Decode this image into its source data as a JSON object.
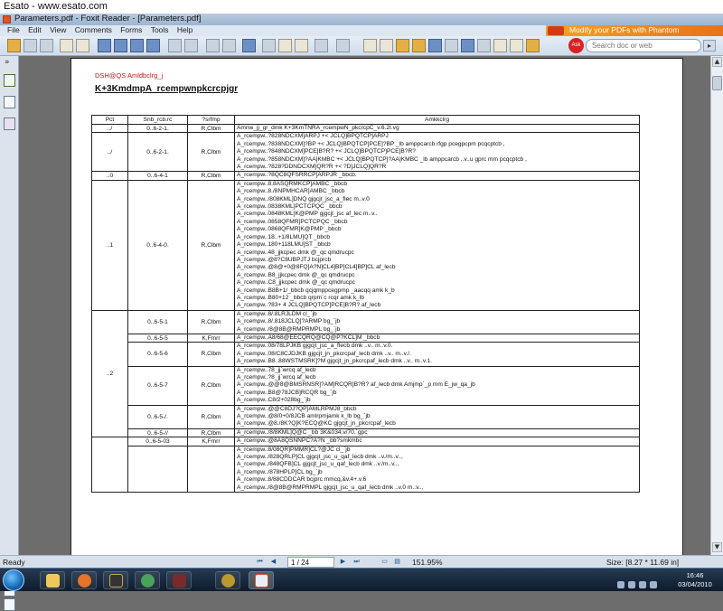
{
  "browser": {
    "title": "Esato - www.esato.com"
  },
  "window": {
    "title": "Parameters.pdf - Foxit Reader - [Parameters.pdf]"
  },
  "menu": [
    "File",
    "Edit",
    "View",
    "Comments",
    "Forms",
    "Tools",
    "Help"
  ],
  "promo": {
    "text": "Modify your PDFs with Phantom"
  },
  "search": {
    "brand": "Ask",
    "placeholder": "Search doc or web"
  },
  "doc": {
    "title": "DSH@QS Amldbclrg_j",
    "subtitle": "K+3KmdmpA_rcempwnpkcrcpjgr",
    "headers": [
      "Pct",
      "Snb_rcb.rc",
      "?srfmp",
      "Amkkclrg"
    ],
    "groups": [
      {
        "pct": "../",
        "subs": [
          {
            "code": "0..6-2-1.",
            "fmt": "R,Clbm",
            "lines": [
              "Amnw_jj_gr_dmk K+3KmTNRA_rcempwN_pkcrcpC_v.6.2I.vg"
            ]
          }
        ]
      },
      {
        "pct": "../",
        "subs": [
          {
            "code": "0..6-2-1.",
            "fmt": "R,Clbm",
            "lines": [
              "A_rcempw..?828NDCXM]ARPJ +< JCLQ]BPQTCP]ARPJ",
              "A_rcempw..?838NDCXM]?BP +< JCLQ]BPQTCP]PCE]?BP _lb amppcarcb rfgp pcegpcpm pcqcptcb ,",
              "A_rcempw..?848NDCXM]PCE]B?R? +< JCLQ]BPQTCP]PCE]B?R?",
              "A_rcempw..?858NDCXM]?AA]KMBC +< JCLQ]BPQTCP]?AA]KMBC _lb amppcarcb ..v..u gprc mm pcqcptcb ,",
              "A_rcempw..?828?DDNDCXM]QR?R +< ?D]JCLQ]QR?R"
            ]
          }
        ]
      },
      {
        "pct": "..0",
        "subs": [
          {
            "code": "0..6-4-1",
            "fmt": "R,Clbm",
            "lines": [
              "A_rcempw..?8QC8QFSRRCP]ARPJR _bbcb."
            ]
          }
        ]
      },
      {
        "pct": "..1",
        "subs": [
          {
            "code": "0..6-4-0.",
            "fmt": "R,Clbm",
            "lines": [
              "A_rcempw..8.8ASQRMKCP]AMBC _bbcb",
              "A_rcempw..8./8NPMHCAR]AMBC _bbcb",
              "A_rcempw../808KML]DNQ gjgcjt_jsc_a_flec m..v.0",
              "A_rcempw..0838KML]PCTCPQC _bbcb",
              "A_rcempw..0848KML]K@PMP gjgcjt_jsc af_lec m..v..",
              "A_rcempw..0858QFMR]PCTCPQC _bbcb",
              "A_rcempw..0868QFMR]K@PMP _bbcb",
              "A_rcempw..18..+1/8LMU]QT _bbcb",
              "A_rcempw..180+118LMU]ST _bbcb",
              "A_rcempw..48_jjkcpec dmk @_qc qmdrucpc",
              "A_rcempw..@8?C8UBPJTJ bcjprcb",
              "A_rcempw..@8@+0@8FQ]A?N]CL4]BP]CL4]BP]CL af_lecb",
              "A_rcempw..B8_jjkcpec dmk @_qc qmdrucpc",
              "A_rcempw..C8_jjkcpec dmk @_qc qmdrucpc",
              "A_rcempw..B8B+1/_bbcb qcjqmppcegpmp _aacqq amk k_b",
              "A_rcempw..B80+12 _bbcb qrpm`c rcqr amk k_lb",
              "A_rcempw..?83+ 4 JCLQ]BPQTCP]PCE]B?R? af_lecb"
            ]
          }
        ]
      },
      {
        "pct": "..2",
        "subs": [
          {
            "code": "0..6-5-1",
            "fmt": "R,Clbm",
            "lines": [
              "A_rcempw..8/.8LRJLDM cl_`jb",
              "A_rcempw..8/.818JCLQ]?ARMP bg_`jb",
              "A_rcempw../8@8B@RMPRMPL bg_`jb"
            ]
          },
          {
            "code": "0..6-5-5",
            "fmt": "K,Fmrr",
            "lines": [
              "A_rcempw..A8/68@EECQRQ@CQ@P?KCL]M _bbcb"
            ]
          },
          {
            "code": "0..6-5-6",
            "fmt": "R,Clbm",
            "lines": [
              "A_rcempw..08/78LPJKB gjgcjt_jsc_a_flecb dmk ..v.. m..v.0.",
              "A_rcempw..08/C8CJDJKB gjgcjt_jn_pkcrcpaf_lecb dmk ..v.. m..v./.",
              "A_rcempw..B8..88WSTMSRK]?M gjgcjt_jn_pkcrcpaf_lecb dmk ..v.. m..v.1."
            ]
          },
          {
            "code": "0..6-5-7",
            "fmt": "R,Clbm",
            "lines": [
              "A_rcempw..78_jj`wrcq af_lecb",
              "A_rcempw..?8_jj`wrcq af_lecb",
              "A_rcempw..@@8@BMSRNSR]?AM]RCQR]B?R? af_lecb dmk Amjmp`_p mm E_jw_qa_jb",
              "A_rcempw..B8@78JCB]RCQR bg_`jb",
              "A_rcempw..C8/2+028bg_`jb"
            ]
          },
          {
            "code": "0..6-5-/.",
            "fmt": "R,Clbm",
            "lines": [
              "A_rcempw..@@C8DJ?QP]AMLRPMJ8_bbcb",
              "A_rcempw..@8/0+0/8JCB amlrpmjamk k_lb bg_`jb",
              "A_rcempw..@8./8K?Q]K?ECQ@KC gjgcjt_jn_pkcrcpaf_lecb"
            ]
          },
          {
            "code": "0..6-5-//",
            "fmt": "R,Clbm",
            "lines": [
              "A_rcempw../8/8KML]Q@C _bb 3K&034.v/70.`gpc"
            ]
          }
        ]
      },
      {
        "pct": "",
        "subs": [
          {
            "code": "0..6-5-03",
            "fmt": "K,Fmrr",
            "lines": [
              "A_rcempw..@8A8QSNNPC?A?N _bb?smkmbc"
            ]
          },
          {
            "code": "",
            "fmt": "",
            "lines": [
              "A_rcempw..8/08QR]PMMR]CL?@JC cl_`jb",
              "A_rcempw../828QRLP]CL gjgcjt_jsc_u_qaf_lecb dmk ..v./m..v..,",
              "A_rcempw../848QFB]CL gjgcjt_jsc_u_qaf_lecb dmk ..v./m..v..,",
              "A_rcempw../878HPLP]CL bg_`jb",
              "A_rcempw..8/88CDDCAR bcjprc mmcq,&v.4+.v.6",
              "A_rcempw../8@8B@RMPRMPL gjgcjt_jsc_u_qaf_lecb dmk ..v.0 m..v..,"
            ]
          }
        ]
      }
    ]
  },
  "status": {
    "ready": "Ready",
    "page_display": "1 / 24",
    "zoom": "151.95%",
    "size": "Size: [8.27 * 11.69 in]"
  },
  "clock": {
    "time": "16:46",
    "date": "03/04/2010"
  },
  "colors": {
    "doc_title": "#c0181a",
    "promo": "#f6a320",
    "taskbar": "#1b2b40"
  }
}
